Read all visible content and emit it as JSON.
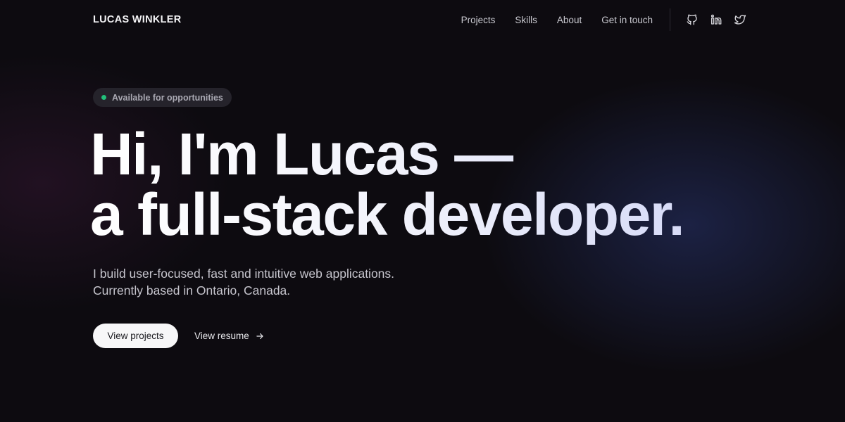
{
  "nav": {
    "brand": "LUCAS WINKLER",
    "links": [
      "Projects",
      "Skills",
      "About",
      "Get in touch"
    ],
    "social_icons": [
      "github-icon",
      "linkedin-icon",
      "twitter-icon"
    ]
  },
  "hero": {
    "badge": "Available for opportunities",
    "headline_line1": "Hi, I'm Lucas —",
    "headline_line2": "a full-stack developer.",
    "subtitle_line1": "I build user-focused, fast and intuitive web applications.",
    "subtitle_line2": "Currently based in Ontario, Canada.",
    "primary_button": "View projects",
    "secondary_link": "View resume"
  },
  "colors": {
    "background": "#0d0b10",
    "status_dot": "#22c07a",
    "button_bg": "#f7f7f8"
  }
}
